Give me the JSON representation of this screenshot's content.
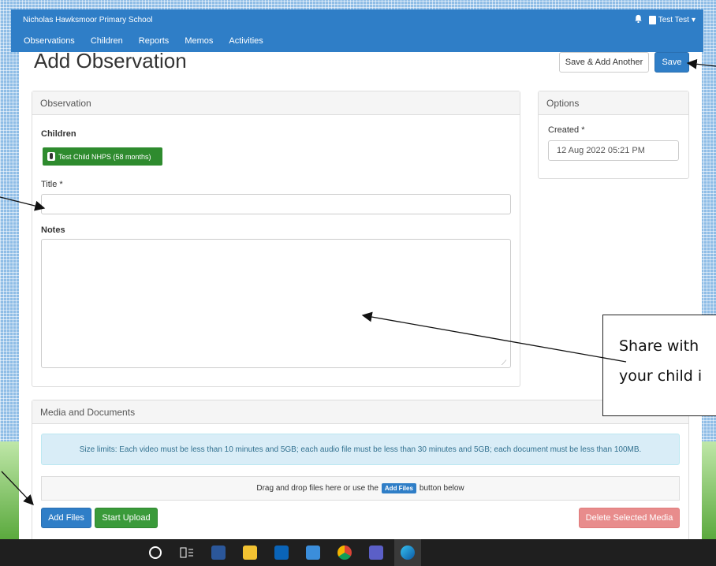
{
  "app": {
    "school_name": "Nicholas Hawksmoor Primary School",
    "user_label": "Test Test"
  },
  "nav": {
    "items": [
      "Observations",
      "Children",
      "Reports",
      "Memos",
      "Activities"
    ]
  },
  "page": {
    "title": "Add Observation",
    "save_add_another": "Save & Add Another",
    "save": "Save"
  },
  "observation": {
    "heading": "Observation",
    "children_label": "Children",
    "child_chip": "Test Child NHPS (58 months)",
    "title_label": "Title *",
    "title_value": "",
    "notes_label": "Notes",
    "notes_value": ""
  },
  "options": {
    "heading": "Options",
    "created_label": "Created *",
    "created_value": "12 Aug 2022 05:21 PM"
  },
  "media": {
    "heading": "Media and Documents",
    "size_limits": "Size limits: Each video must be less than 10 minutes and 5GB; each audio file must be less than 30 minutes and 5GB; each document must be less than 100MB.",
    "drop_text_before": "Drag and drop files here or use the",
    "drop_inline_button": "Add Files",
    "drop_text_after": "button below",
    "add_files": "Add Files",
    "start_upload": "Start Upload",
    "delete_selected": "Delete Selected Media"
  },
  "annotation": {
    "line1": "Share with",
    "line2": "your child i"
  },
  "taskbar": {
    "icons": [
      "search-circle-icon",
      "task-view-icon",
      "word-icon",
      "file-explorer-icon",
      "outlook-icon",
      "app-icon",
      "chrome-icon",
      "teams-icon",
      "edge-icon"
    ]
  },
  "colors": {
    "primary": "#2f7ec7",
    "success": "#3a9a3a",
    "danger": "#e88c8c",
    "info_bg": "#d9edf7"
  }
}
